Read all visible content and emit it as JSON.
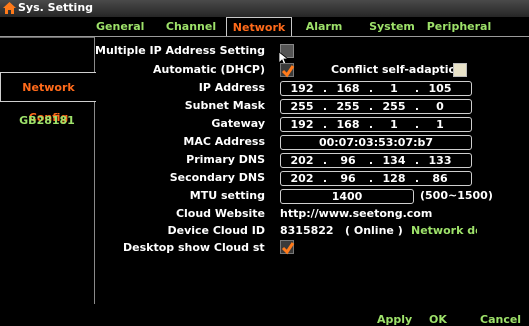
{
  "window": {
    "title": "Sys. Setting",
    "icon": "home-icon"
  },
  "tabs": [
    {
      "label": "General"
    },
    {
      "label": "Channel"
    },
    {
      "label": "Network"
    },
    {
      "label": "Alarm"
    },
    {
      "label": "System"
    },
    {
      "label": "Peripheral"
    }
  ],
  "sidebar": {
    "items": [
      {
        "label": "Network Config",
        "active": true
      },
      {
        "label": "GB28181",
        "active": false
      }
    ]
  },
  "form": {
    "multiple_ip_label": "Multiple IP Address Setting",
    "dhcp_label": "Automatic (DHCP)",
    "dhcp_checked": true,
    "conflict_label": "Conflict self-adaption",
    "conflict_checked": false,
    "ip_label": "IP Address",
    "ip": [
      "192",
      "168",
      "1",
      "105"
    ],
    "subnet_label": "Subnet Mask",
    "subnet": [
      "255",
      "255",
      "255",
      "0"
    ],
    "gateway_label": "Gateway",
    "gateway": [
      "192",
      "168",
      "1",
      "1"
    ],
    "mac_label": "MAC Address",
    "mac": "00:07:03:53:07:b7",
    "dns1_label": "Primary DNS",
    "dns1": [
      "202",
      "96",
      "134",
      "133"
    ],
    "dns2_label": "Secondary DNS",
    "dns2": [
      "202",
      "96",
      "128",
      "86"
    ],
    "mtu_label": "MTU setting",
    "mtu": "1400",
    "mtu_range": "(500~1500)",
    "cloud_website_label": "Cloud Website",
    "cloud_website": "http://www.seetong.com",
    "cloud_id_label": "Device Cloud ID",
    "cloud_id": "8315822",
    "cloud_status": "( Online )",
    "network_detect": "Network dete",
    "desktop_cloud_label": "Desktop show Cloud status",
    "desktop_cloud_checked": true
  },
  "footer": {
    "apply": "Apply",
    "ok": "OK",
    "cancel": "Cancel"
  },
  "colors": {
    "accent_active": "#ff6a1a",
    "tab_text": "#9ee26a",
    "check": "#ff7a1a"
  }
}
